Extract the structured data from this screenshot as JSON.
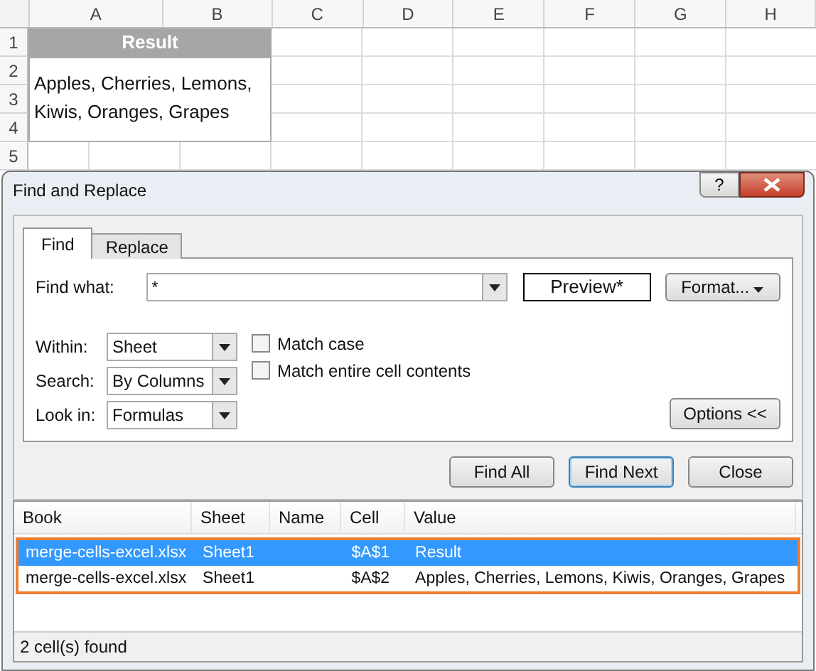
{
  "sheet": {
    "columns": [
      "A",
      "B",
      "C",
      "D",
      "E",
      "F",
      "G",
      "H"
    ],
    "rows": [
      "1",
      "2",
      "3",
      "4",
      "5"
    ],
    "header_cell": "Result",
    "value_cell": "Apples, Cherries, Lemons, Kiwis, Oranges, Grapes"
  },
  "window": {
    "title": "Find and Replace",
    "help": "?"
  },
  "tabs": [
    {
      "label": "Find",
      "selected": true
    },
    {
      "label": "Replace",
      "selected": false
    }
  ],
  "find_what": {
    "label": "Find what:",
    "value": "*"
  },
  "preview": "Preview*",
  "format_button": "Format...",
  "options": [
    {
      "label": "Within:",
      "value": "Sheet"
    },
    {
      "label": "Search:",
      "value": "By Columns"
    },
    {
      "label": "Look in:",
      "value": "Formulas"
    }
  ],
  "checkboxes": [
    {
      "label": "Match case",
      "checked": false
    },
    {
      "label": "Match entire cell contents",
      "checked": false
    }
  ],
  "options_button": "Options <<",
  "buttons": [
    {
      "label": "Find All",
      "default": false
    },
    {
      "label": "Find Next",
      "default": true
    },
    {
      "label": "Close",
      "default": false
    }
  ],
  "results": {
    "columns": [
      "Book",
      "Sheet",
      "Name",
      "Cell",
      "Value"
    ],
    "rows": [
      {
        "cells": [
          "merge-cells-excel.xlsx",
          "Sheet1",
          "",
          "$A$1",
          "Result"
        ],
        "selected": true
      },
      {
        "cells": [
          "merge-cells-excel.xlsx",
          "Sheet1",
          "",
          "$A$2",
          "Apples, Cherries, Lemons, Kiwis, Oranges, Grapes"
        ],
        "selected": false
      }
    ]
  },
  "status_bar": "2 cell(s) found"
}
